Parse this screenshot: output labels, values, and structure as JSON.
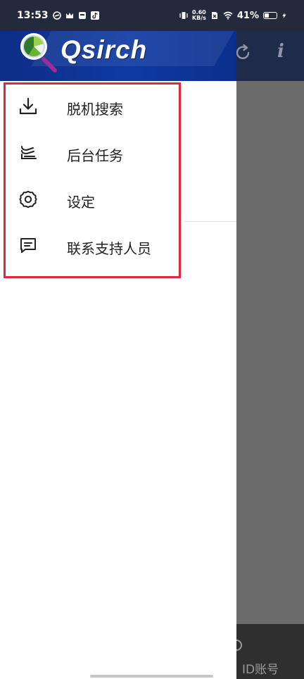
{
  "status_bar": {
    "time": "13:53",
    "net_speed_value": "0.60",
    "net_speed_unit": "KB/s",
    "battery": "41%",
    "battery_level": 0.41
  },
  "header": {
    "app_name": "Qsirch"
  },
  "background": {
    "info_glyph": "i",
    "bottom_text": "ID账号"
  },
  "menu": {
    "items": [
      {
        "label": "脱机搜索",
        "icon": "download-icon"
      },
      {
        "label": "后台任务",
        "icon": "background-tasks-icon"
      },
      {
        "label": "设定",
        "icon": "gear-icon"
      },
      {
        "label": "联系支持人员",
        "icon": "message-icon"
      }
    ]
  },
  "colors": {
    "header_blue": "#0f3aa3",
    "highlight_red": "#e0283a"
  }
}
